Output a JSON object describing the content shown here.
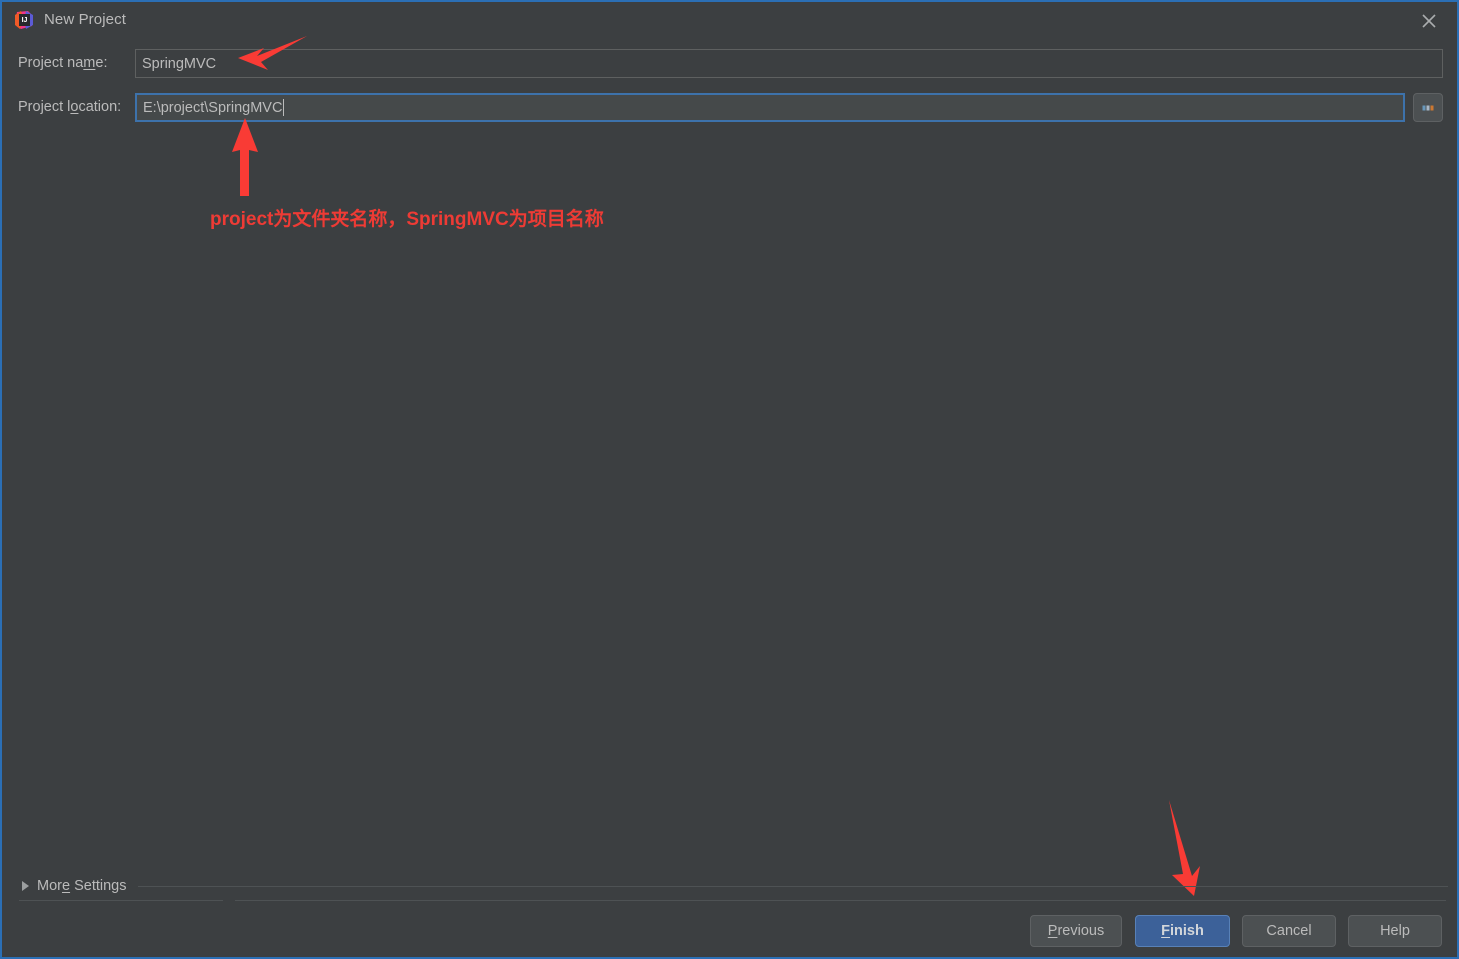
{
  "window": {
    "title": "New Project",
    "app_icon": "intellij-idea-icon",
    "close_icon": "close-icon",
    "accent_border_color": "#2b6fb5",
    "background_color": "#3c3f41"
  },
  "form": {
    "project_name": {
      "label_before": "Project na",
      "label_mnemonic": "m",
      "label_after": "e:",
      "value": "SpringMVC",
      "placeholder": ""
    },
    "project_location": {
      "label_before": "Project l",
      "label_mnemonic": "o",
      "label_after": "cation:",
      "value": "E:\\project\\SpringMVC",
      "placeholder": "",
      "focused": true,
      "focus_color": "#3d72ab"
    },
    "browse_button": {
      "icon": "ellipsis-icon",
      "tooltip": "..."
    }
  },
  "annotations": {
    "color": "#ee3b35",
    "note_text": "project为文件夹名称，SpringMVC为项目名称",
    "arrows": [
      {
        "name": "arrow-to-project-name",
        "direction": "left-down"
      },
      {
        "name": "arrow-to-project-location",
        "direction": "up"
      },
      {
        "name": "arrow-to-finish-button",
        "direction": "down-right"
      }
    ]
  },
  "more_settings": {
    "label_before": "Mor",
    "label_mnemonic": "e",
    "label_after": " Settings",
    "expanded": false,
    "triangle_icon": "chevron-right-icon"
  },
  "buttons": {
    "previous": {
      "before": "",
      "mnemonic": "P",
      "after": "revious",
      "primary": false
    },
    "finish": {
      "before": "",
      "mnemonic": "F",
      "after": "inish",
      "primary": true,
      "color": "#3c6199"
    },
    "cancel": {
      "before": "Cancel",
      "mnemonic": "",
      "after": "",
      "primary": false
    },
    "help": {
      "before": "Help",
      "mnemonic": "",
      "after": "",
      "primary": false
    }
  }
}
